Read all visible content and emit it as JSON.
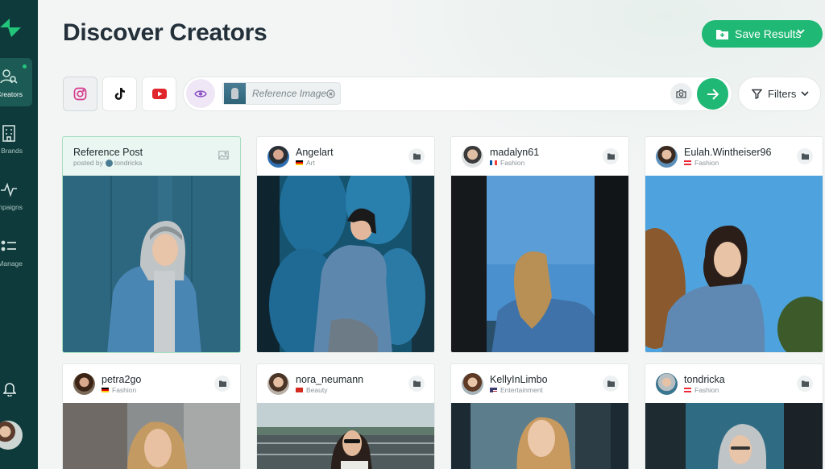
{
  "title": "Discover Creators",
  "save_results": {
    "label": "Save Results"
  },
  "nav": [
    {
      "label": "Creators",
      "icon": "creators-icon",
      "active": true
    },
    {
      "label": "Brands",
      "icon": "building-icon",
      "active": false
    },
    {
      "label": "Campaigns",
      "icon": "pulse-icon",
      "active": false
    },
    {
      "label": "Manage",
      "icon": "list-icon",
      "active": false
    }
  ],
  "search": {
    "platforms": [
      "instagram",
      "tiktok",
      "youtube"
    ],
    "selected_platform": "instagram",
    "reference_chip_label": "Reference Image"
  },
  "filters": {
    "label": "Filters"
  },
  "reference_card": {
    "title": "Reference Post",
    "posted_by_prefix": "posted by",
    "posted_by_user": "tondricka"
  },
  "cards": [
    {
      "name": "Angelart",
      "category": "Art"
    },
    {
      "name": "madalyn61",
      "category": "Fashion"
    },
    {
      "name": "Eulah.Wintheiser96",
      "category": "Fashion"
    },
    {
      "name": "petra2go",
      "category": "Fashion"
    },
    {
      "name": "nora_neumann",
      "category": "Beauty"
    },
    {
      "name": "KellyInLimbo",
      "category": "Entertainment"
    },
    {
      "name": "tondricka",
      "category": "Fashion"
    }
  ],
  "colors": {
    "accent": "#1fb874",
    "sidebar": "#0f3a3c",
    "sidebar_active": "#1c5a55"
  }
}
